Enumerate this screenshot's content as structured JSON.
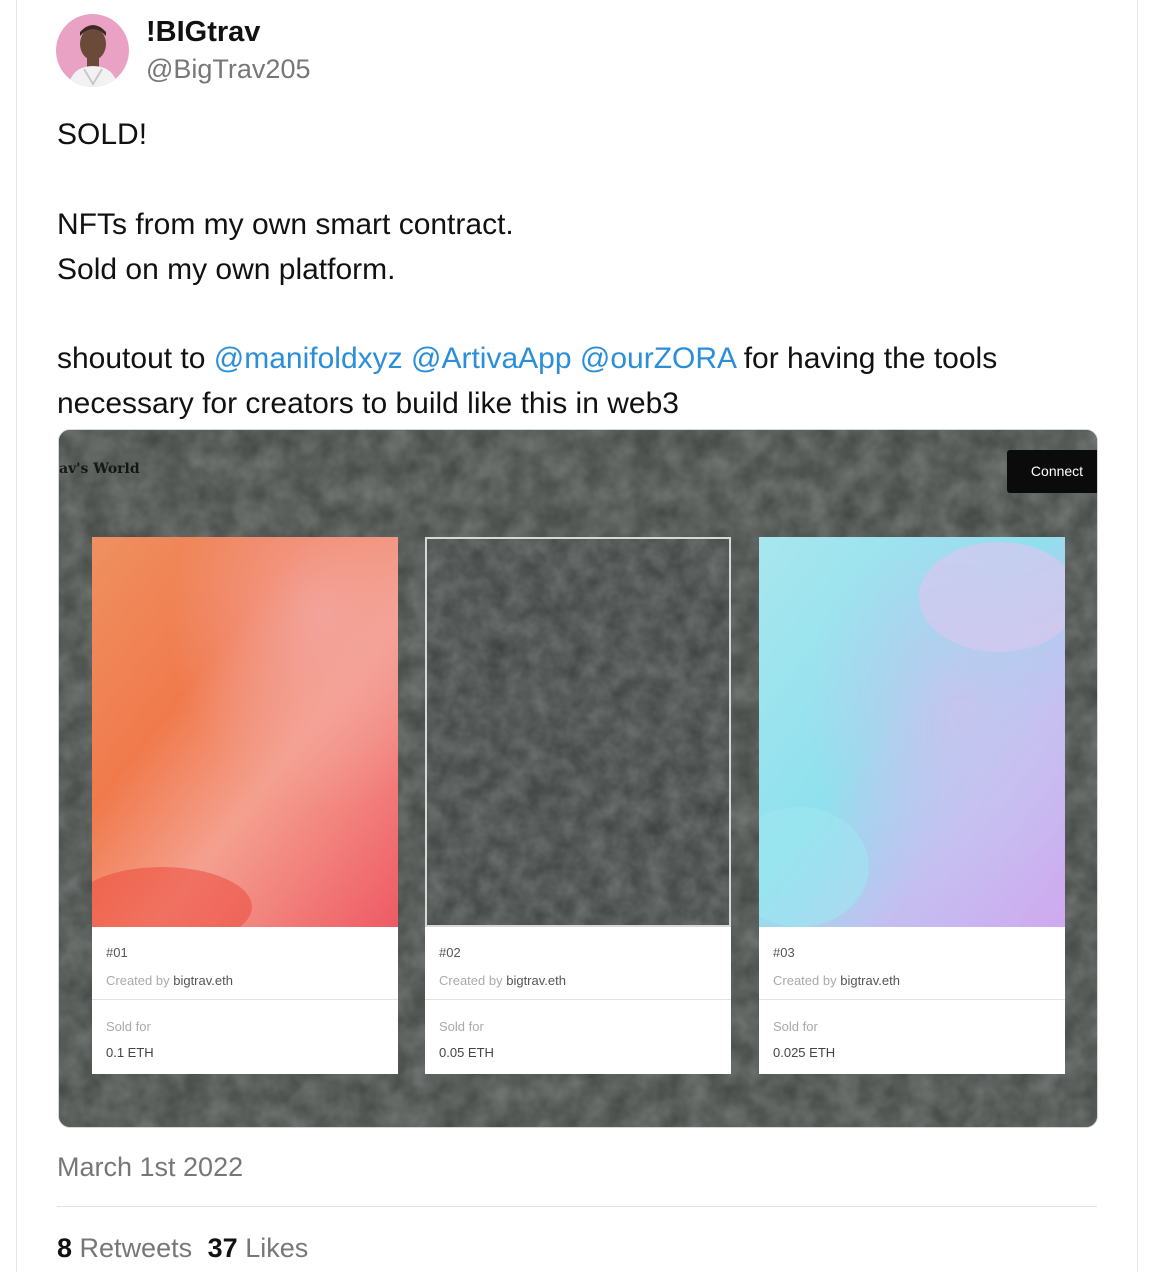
{
  "tweet": {
    "display_name": "!BIGtrav",
    "handle": "@BigTrav205",
    "line1": "SOLD!",
    "line2": "NFTs from my own smart contract.",
    "line3": "Sold on my own platform.",
    "shoutout_prefix": "shoutout to ",
    "mentions": [
      "@manifoldxyz",
      "@ArtivaApp",
      "@ourZORA"
    ],
    "shoutout_suffix": " for having the tools",
    "line5": "necessary for creators to build like this in web3",
    "date": "March 1st 2022",
    "retweets_count": "8",
    "retweets_label": "Retweets",
    "likes_count": "37",
    "likes_label": "Likes"
  },
  "embed": {
    "site_title": "av's World",
    "connect_label": "Connect",
    "nfts": [
      {
        "number": "#01",
        "created_by_label": "Created by",
        "creator": "bigtrav.eth",
        "sold_label": "Sold for",
        "price": "0.1 ETH"
      },
      {
        "number": "#02",
        "created_by_label": "Created by",
        "creator": "bigtrav.eth",
        "sold_label": "Sold for",
        "price": "0.05 ETH"
      },
      {
        "number": "#03",
        "created_by_label": "Created by",
        "creator": "bigtrav.eth",
        "sold_label": "Sold for",
        "price": "0.025 ETH"
      }
    ]
  },
  "colors": {
    "mention": "#2a8fd8",
    "embed_background": "#3d413e",
    "avatar_background": "#eaa2c4"
  }
}
